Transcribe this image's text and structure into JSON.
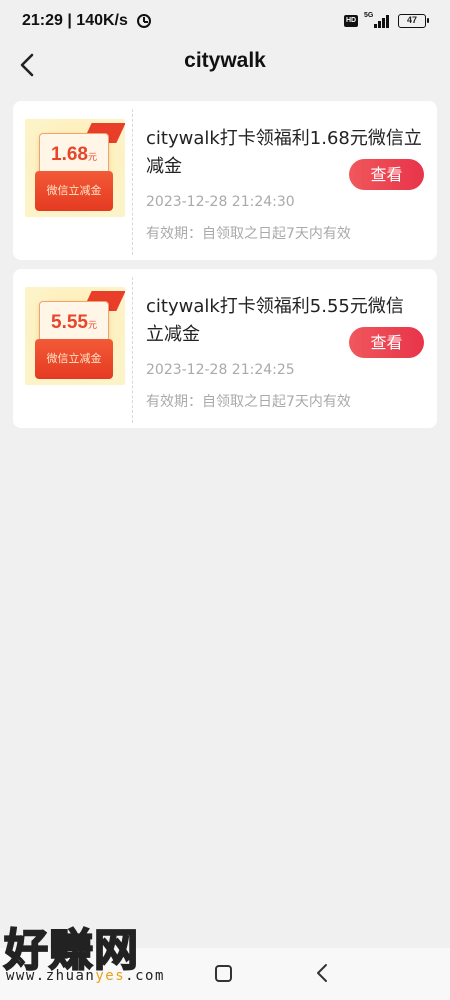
{
  "status_bar": {
    "time_speed": "21:29 | 140K/s",
    "hd_label": "HD",
    "network": "5G",
    "battery": "47"
  },
  "header": {
    "title": "citywalk"
  },
  "coupons": [
    {
      "amount": "1.68",
      "unit": "元",
      "label": "微信立减金",
      "title_line1": "citywalk打卡领福利1.68元微信立",
      "title_line2": "减金",
      "button_label": "查看",
      "time": "2023-12-28 21:24:30",
      "validity": "有效期：自领取之日起7天内有效"
    },
    {
      "amount": "5.55",
      "unit": "元",
      "label": "微信立减金",
      "title_line1": "citywalk打卡领福利5.55元微信",
      "title_line2": "立减金",
      "button_label": "查看",
      "time": "2023-12-28 21:24:25",
      "validity": "有效期：自领取之日起7天内有效"
    }
  ],
  "watermark": {
    "text": "好赚网",
    "url_prefix": "www.zhuan",
    "url_highlight": "yes",
    "url_suffix": ".com"
  },
  "colors": {
    "accent": "#e8344a",
    "background": "#f0f0f0",
    "coupon_red": "#e8452b"
  },
  "icons": {
    "back": "chevron-left-icon",
    "alarm": "alarm-clock-icon",
    "home": "square-home-icon",
    "nav_back": "triangle-back-icon"
  }
}
